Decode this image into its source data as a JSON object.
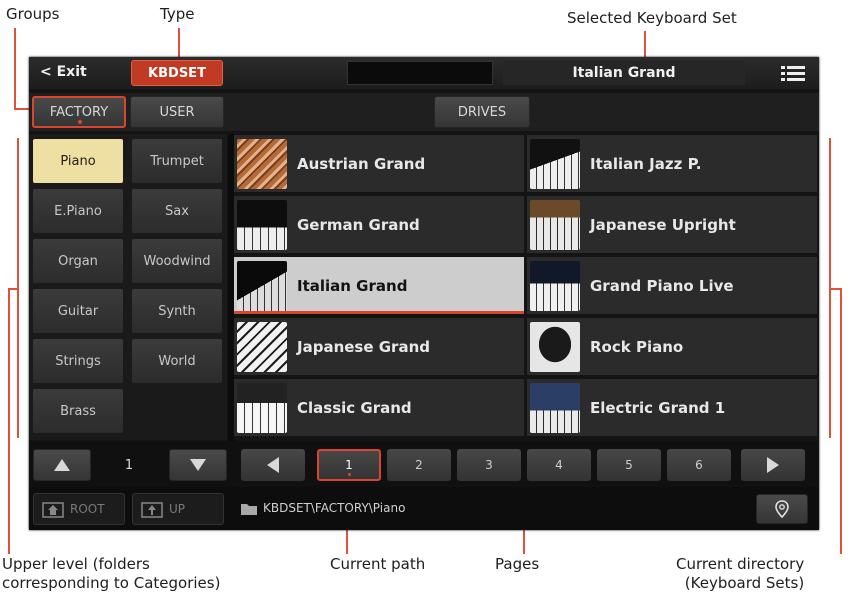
{
  "callouts": {
    "groups": "Groups",
    "type": "Type",
    "selected_set": "Selected Keyboard Set",
    "upper_level": "Upper level (folders\ncorresponding to Categories)",
    "current_path": "Current path",
    "pages": "Pages",
    "current_directory": "Current directory\n(Keyboard Sets)"
  },
  "header": {
    "exit_label": "< Exit",
    "type_label": "KBDSET",
    "selected_name": "Italian Grand"
  },
  "groups": {
    "factory": "FACTORY",
    "user": "USER",
    "drives": "DRIVES"
  },
  "categories": [
    "Piano",
    "Trumpet",
    "E.Piano",
    "Sax",
    "Organ",
    "Woodwind",
    "Guitar",
    "Synth",
    "Strings",
    "World",
    "Brass"
  ],
  "selected_category": "Piano",
  "category_page": "1",
  "nav": {
    "root": "ROOT",
    "up": "UP"
  },
  "sets": [
    "Austrian Grand",
    "Italian Jazz P.",
    "German Grand",
    "Japanese Upright",
    "Italian Grand",
    "Grand Piano Live",
    "Japanese Grand",
    "Rock Piano",
    "Classic Grand",
    "Electric Grand 1"
  ],
  "selected_set": "Italian Grand",
  "pages": [
    "1",
    "2",
    "3",
    "4",
    "5",
    "6"
  ],
  "selected_page": "1",
  "path": "KBDSET\\FACTORY\\Piano",
  "colors": {
    "accent": "#d9452e",
    "selected_category_bg": "#eedfa2",
    "selected_item_bg": "#cdcdcd"
  }
}
